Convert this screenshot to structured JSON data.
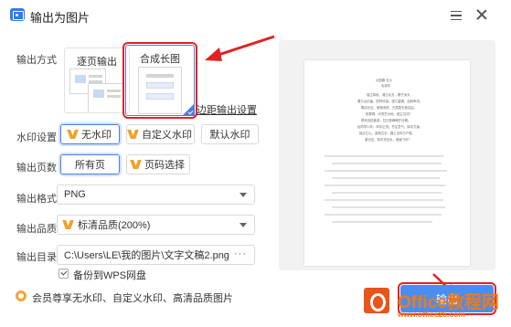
{
  "window": {
    "title": "输出为图片",
    "colors": {
      "accent": "#4a7fe0",
      "primary_button": "#4a8df0",
      "vip": "#f0a22b",
      "highlight": "#e0231f"
    }
  },
  "output_mode": {
    "label": "输出方式",
    "options": [
      "逐页输出",
      "合成长图"
    ],
    "selected": "合成长图",
    "edge_link": "边距输出设置"
  },
  "watermark": {
    "label": "水印设置",
    "options": [
      "无水印",
      "自定义水印",
      "默认水印"
    ],
    "selected": "无水印"
  },
  "pages": {
    "label": "输出页数",
    "options": [
      "所有页",
      "页码选择"
    ],
    "selected": "所有页"
  },
  "format": {
    "label": "输出格式",
    "value": "PNG"
  },
  "quality": {
    "label": "输出品质",
    "value": "标清品质(200%)"
  },
  "directory": {
    "label": "输出目录",
    "value": "C:\\Users\\LE\\我的图片\\文字文稿2.png",
    "more": "···"
  },
  "backup": {
    "label": "备份到WPS网盘",
    "checked": true
  },
  "vip_note": "会员尊享无水印、自定义水印、高清品质图片",
  "output_button": "输出",
  "preview": {
    "lines": [
      "沁园春·长沙",
      "毛泽东",
      "独立寒秋，湘江北去，橘子洲头。",
      "看万山红遍，层林尽染；漫江碧透，百舸争流。",
      "鹰击长空，鱼翔浅底，万类霜天竞自由。",
      "怅寥廓，问苍茫大地，谁主沉浮？",
      "携来百侣曾游，忆往昔峥嵘岁月稠。",
      "恰同学少年，风华正茂；书生意气，挥斥方遒。",
      "指点江山，激扬文字，粪土当年万户侯。",
      "曾记否，到中流击水，浪遏飞舟？"
    ]
  },
  "overlay_watermark": {
    "brand": "Office教程网",
    "url": "www.office26.com"
  }
}
